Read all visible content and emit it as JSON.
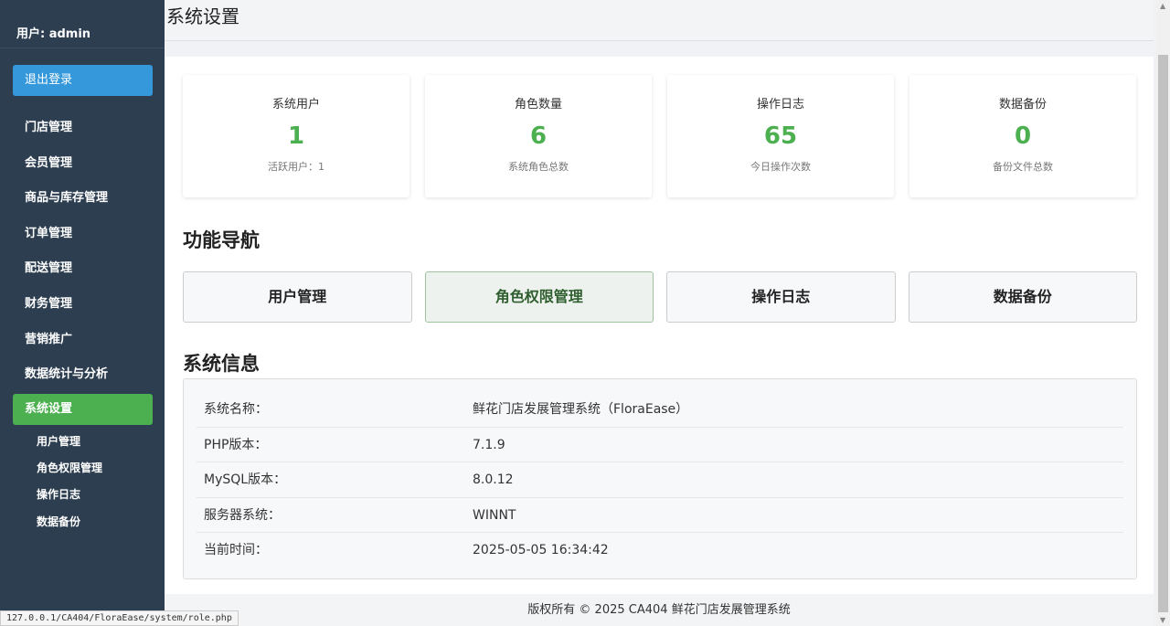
{
  "sidebar": {
    "user": "用户: admin",
    "logout": "退出登录",
    "menu": [
      "门店管理",
      "会员管理",
      "商品与库存管理",
      "订单管理",
      "配送管理",
      "财务管理",
      "营销推广",
      "数据统计与分析"
    ],
    "active": "系统设置",
    "submenu": [
      "用户管理",
      "角色权限管理",
      "操作日志",
      "数据备份"
    ]
  },
  "header": {
    "title": "系统设置"
  },
  "stats": [
    {
      "label": "系统用户",
      "value": "1",
      "sub": "活跃用户：1"
    },
    {
      "label": "角色数量",
      "value": "6",
      "sub": "系统角色总数"
    },
    {
      "label": "操作日志",
      "value": "65",
      "sub": "今日操作次数"
    },
    {
      "label": "数据备份",
      "value": "0",
      "sub": "备份文件总数"
    }
  ],
  "nav": {
    "title": "功能导航",
    "buttons": [
      "用户管理",
      "角色权限管理",
      "操作日志",
      "数据备份"
    ]
  },
  "info": {
    "title": "系统信息",
    "rows": [
      {
        "key": "系统名称：",
        "value": "鲜花门店发展管理系统（FloraEase）"
      },
      {
        "key": "PHP版本：",
        "value": "7.1.9"
      },
      {
        "key": "MySQL版本：",
        "value": "8.0.12"
      },
      {
        "key": "服务器系统：",
        "value": "WINNT"
      },
      {
        "key": "当前时间：",
        "value": "2025-05-05 16:34:42"
      }
    ]
  },
  "footer": "版权所有 © 2025 CA404 鲜花门店发展管理系统",
  "status_url": "127.0.0.1/CA404/FloraEase/system/role.php",
  "colors": {
    "sidebar": "#2c3e50",
    "logout": "#3498db",
    "active": "#4caf50",
    "stat_value": "#4caf50"
  }
}
